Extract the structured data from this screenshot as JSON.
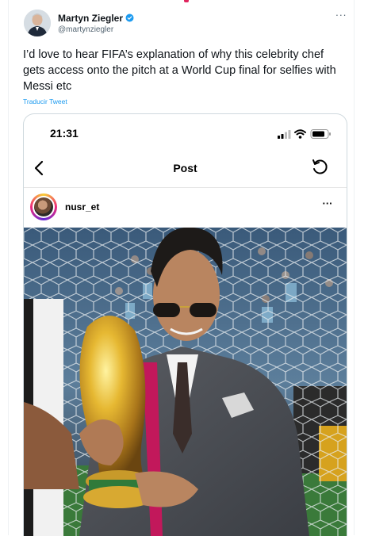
{
  "tweet": {
    "author_name": "Martyn Ziegler",
    "author_handle": "@martynziegler",
    "more_label": "···",
    "text": "I’d love to hear FIFA’s explanation of why this celebrity chef gets access onto the pitch at a World Cup final for selfies with Messi etc",
    "translate_label": "Traducir Tweet"
  },
  "embedded": {
    "status_time": "21:31",
    "nav_title": "Post",
    "post_username": "nusr_et",
    "post_more_label": "···"
  },
  "colors": {
    "accent": "#1d9bf0",
    "text": "#0f1419",
    "muted": "#536471"
  },
  "icons": [
    "verified-badge-icon",
    "more-icon",
    "signal-icon",
    "wifi-icon",
    "battery-icon",
    "back-arrow-icon",
    "refresh-icon"
  ]
}
